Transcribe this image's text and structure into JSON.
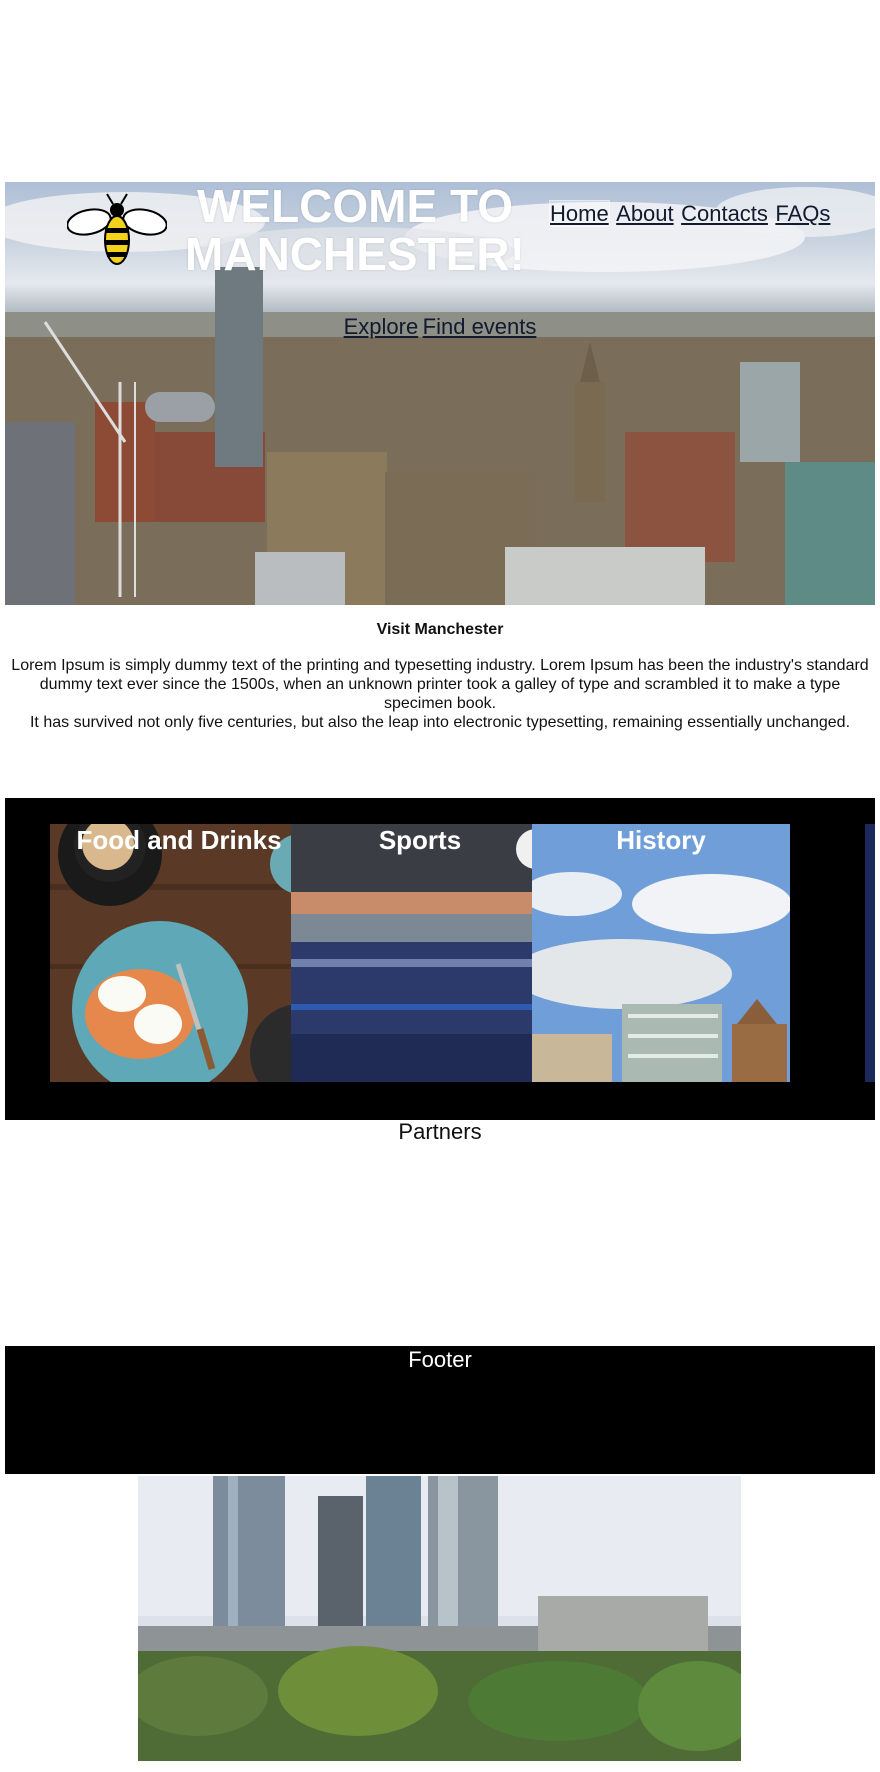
{
  "hero": {
    "title": "WELCOME TO MANCHESTER!",
    "logo_icon": "manchester-bee-icon",
    "nav": [
      {
        "label": "Home",
        "active": true
      },
      {
        "label": "About",
        "active": false
      },
      {
        "label": "Contacts",
        "active": false
      },
      {
        "label": "FAQs",
        "active": false
      }
    ],
    "subnav": [
      {
        "label": "Explore"
      },
      {
        "label": "Find events"
      }
    ]
  },
  "intro": {
    "heading": "Visit Manchester",
    "paragraph_1": "Lorem Ipsum is simply dummy text of the printing and typesetting industry. Lorem Ipsum has been the industry's standard dummy text ever since the 1500s, when an unknown printer took a galley of type and scrambled it to make a type specimen book.",
    "paragraph_2": "It has survived not only five centuries, but also the leap into electronic typesetting, remaining essentially unchanged."
  },
  "carousel": {
    "cards": [
      {
        "title": "Food and Drinks"
      },
      {
        "title": "Sports"
      },
      {
        "title": "History"
      }
    ]
  },
  "partners": {
    "title": "Partners"
  },
  "footer": {
    "title": "Footer"
  },
  "colors": {
    "carousel_bg": "#000000",
    "footer_bg": "#000000",
    "link": "#111a2e"
  }
}
